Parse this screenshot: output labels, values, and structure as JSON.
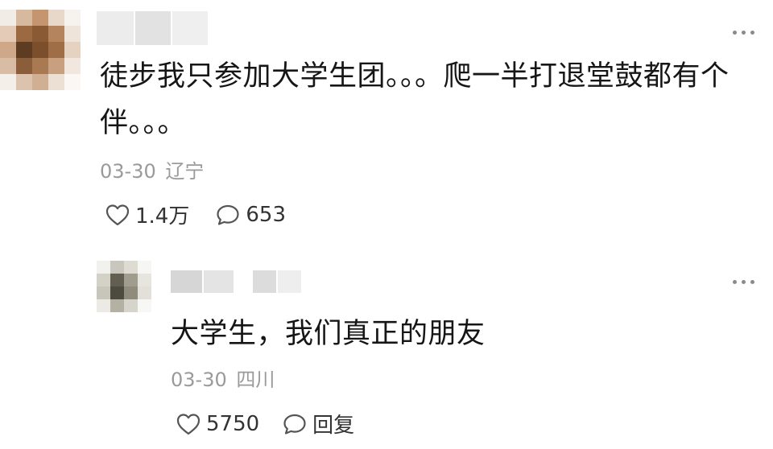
{
  "comment": {
    "text": "徒步我只参加大学生团。。。爬一半打退堂鼓都有个伴。。。",
    "date": "03-30",
    "location": "辽宁",
    "like_count": "1.4万",
    "reply_count": "653",
    "like_icon": "heart-outline-icon",
    "reply_icon": "speech-bubble-icon",
    "more_icon": "more-dots-icon"
  },
  "reply": {
    "text": "大学生，我们真正的朋友",
    "date": "03-30",
    "location": "四川",
    "like_count": "5750",
    "reply_label": "回复",
    "like_icon": "heart-outline-icon",
    "reply_icon": "speech-bubble-icon",
    "more_icon": "more-dots-icon"
  },
  "colors": {
    "text": "#161616",
    "meta": "#9a9a9a",
    "icon": "#555555"
  }
}
